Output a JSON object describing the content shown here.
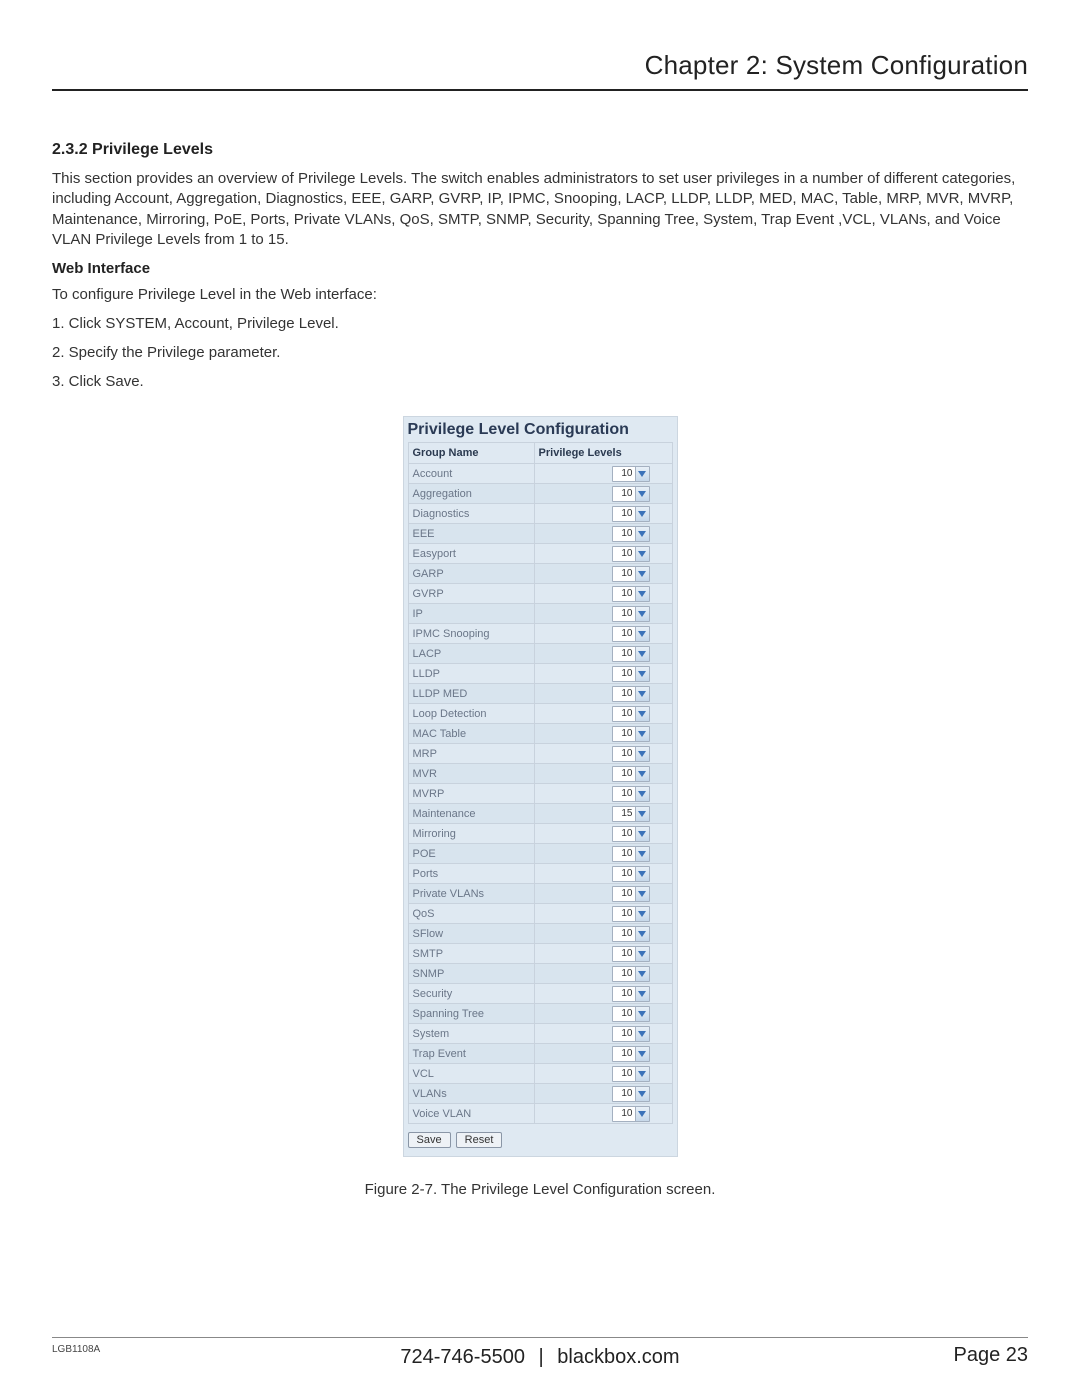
{
  "header": {
    "chapter_title": "Chapter 2: System Configuration"
  },
  "section": {
    "number_title": "2.3.2 Privilege Levels",
    "overview": "This section provides an overview of Privilege Levels. The switch enables administrators to set user privileges in a number of different categories, including Account, Aggregation, Diagnostics, EEE, GARP, GVRP, IP, IPMC, Snooping, LACP, LLDP, LLDP, MED, MAC, Table, MRP, MVR, MVRP, Maintenance, Mirroring, PoE, Ports, Private VLANs, QoS, SMTP, SNMP, Security, Spanning Tree, System, Trap Event ,VCL, VLANs, and Voice VLAN Privilege Levels from 1 to 15.",
    "web_interface_heading": "Web Interface",
    "web_interface_intro": "To configure Privilege Level in the Web interface:",
    "steps": [
      "1. Click SYSTEM, Account, Privilege Level.",
      "2. Specify the Privilege parameter.",
      "3. Click Save."
    ]
  },
  "panel": {
    "title": "Privilege Level Configuration",
    "col_group": "Group Name",
    "col_level": "Privilege Levels",
    "rows": [
      {
        "name": "Account",
        "value": "10"
      },
      {
        "name": "Aggregation",
        "value": "10"
      },
      {
        "name": "Diagnostics",
        "value": "10"
      },
      {
        "name": "EEE",
        "value": "10"
      },
      {
        "name": "Easyport",
        "value": "10"
      },
      {
        "name": "GARP",
        "value": "10"
      },
      {
        "name": "GVRP",
        "value": "10"
      },
      {
        "name": "IP",
        "value": "10"
      },
      {
        "name": "IPMC Snooping",
        "value": "10"
      },
      {
        "name": "LACP",
        "value": "10"
      },
      {
        "name": "LLDP",
        "value": "10"
      },
      {
        "name": "LLDP MED",
        "value": "10"
      },
      {
        "name": "Loop Detection",
        "value": "10"
      },
      {
        "name": "MAC Table",
        "value": "10"
      },
      {
        "name": "MRP",
        "value": "10"
      },
      {
        "name": "MVR",
        "value": "10"
      },
      {
        "name": "MVRP",
        "value": "10"
      },
      {
        "name": "Maintenance",
        "value": "15"
      },
      {
        "name": "Mirroring",
        "value": "10"
      },
      {
        "name": "POE",
        "value": "10"
      },
      {
        "name": "Ports",
        "value": "10"
      },
      {
        "name": "Private VLANs",
        "value": "10"
      },
      {
        "name": "QoS",
        "value": "10"
      },
      {
        "name": "SFlow",
        "value": "10"
      },
      {
        "name": "SMTP",
        "value": "10"
      },
      {
        "name": "SNMP",
        "value": "10"
      },
      {
        "name": "Security",
        "value": "10"
      },
      {
        "name": "Spanning Tree",
        "value": "10"
      },
      {
        "name": "System",
        "value": "10"
      },
      {
        "name": "Trap Event",
        "value": "10"
      },
      {
        "name": "VCL",
        "value": "10"
      },
      {
        "name": "VLANs",
        "value": "10"
      },
      {
        "name": "Voice VLAN",
        "value": "10"
      }
    ],
    "buttons": {
      "save": "Save",
      "reset": "Reset"
    }
  },
  "figure_caption": "Figure 2-7. The Privilege Level Configuration screen.",
  "footer": {
    "model": "LGB1108A",
    "phone": "724-746-5500",
    "site": "blackbox.com",
    "separator": "|",
    "page_label": "Page 23"
  }
}
